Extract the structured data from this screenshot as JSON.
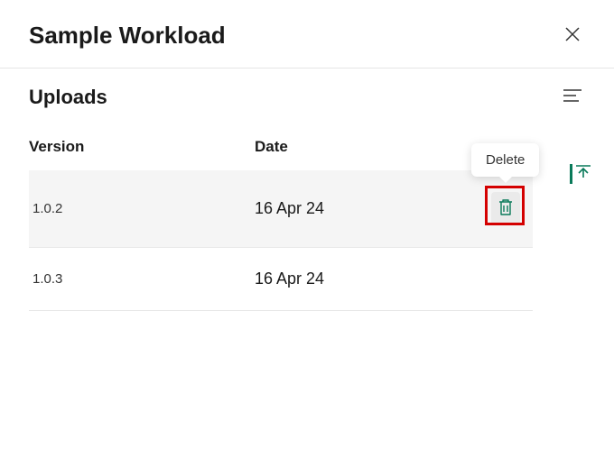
{
  "header": {
    "title": "Sample Workload"
  },
  "section": {
    "title": "Uploads"
  },
  "table": {
    "columns": {
      "version": "Version",
      "date": "Date"
    },
    "rows": [
      {
        "version": "1.0.2",
        "date": "16 Apr 24",
        "highlighted": true,
        "showDelete": true
      },
      {
        "version": "1.0.3",
        "date": "16 Apr 24",
        "highlighted": false,
        "showDelete": false
      }
    ]
  },
  "tooltip": {
    "delete": "Delete"
  },
  "colors": {
    "accent": "#0a7a5a",
    "highlight_border": "#d40000"
  }
}
